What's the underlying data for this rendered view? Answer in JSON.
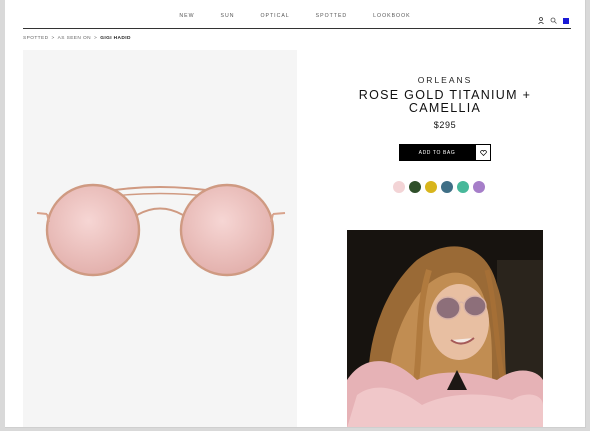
{
  "nav": {
    "items": [
      "NEW",
      "SUN",
      "OPTICAL",
      "SPOTTED",
      "LOOKBOOK"
    ],
    "account_icon": "account-icon",
    "search_icon": "search-icon",
    "bag_icon": "bag-icon"
  },
  "breadcrumb": {
    "spotted": "SPOTTED",
    "sep1": ">",
    "as_seen_on": "AS SEEN ON",
    "sep2": ">",
    "current": "GIGI HADID"
  },
  "product": {
    "brand": "ORLEANS",
    "name": "ROSE GOLD TITANIUM + CAMELLIA",
    "price": "$295",
    "add_to_bag_label": "ADD TO BAG",
    "wishlist_icon": "heart-icon"
  },
  "colors": {
    "accent": "#000000",
    "bag_icon": "#1a1ad6",
    "variant_swatches": [
      "#f3d4d6",
      "#2f4f2a",
      "#d8b51c",
      "#3f6f86",
      "#47b89a",
      "#a67ec9"
    ]
  }
}
